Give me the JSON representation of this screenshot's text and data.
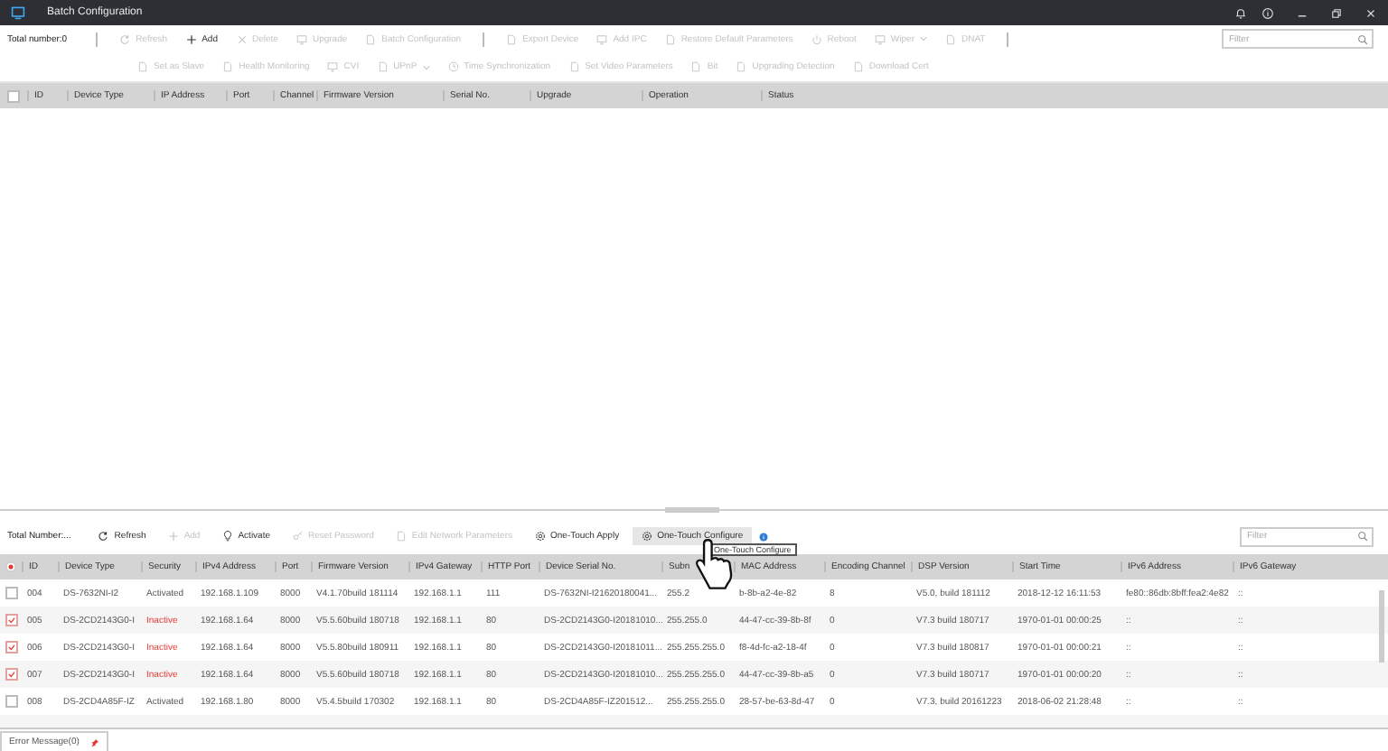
{
  "window": {
    "title": "Batch Configuration"
  },
  "upper_toolbar": {
    "total": "Total number:0",
    "filter_placeholder": "Filter",
    "primary_buttons": [
      {
        "label": "Refresh",
        "disabled": true
      },
      {
        "label": "Add",
        "disabled": false
      },
      {
        "label": "Delete",
        "disabled": true
      },
      {
        "label": "Upgrade",
        "disabled": true
      },
      {
        "label": "Batch Configuration",
        "disabled": true
      },
      {
        "label": "Export Device",
        "disabled": true
      },
      {
        "label": "Add IPC",
        "disabled": true
      },
      {
        "label": "Restore Default Parameters",
        "disabled": true
      },
      {
        "label": "Reboot",
        "disabled": true
      },
      {
        "label": "Wiper",
        "disabled": true
      },
      {
        "label": "DNAT",
        "disabled": true
      }
    ],
    "secondary_buttons": [
      {
        "label": "Set as Slave",
        "disabled": true
      },
      {
        "label": "Health Monitoring",
        "disabled": true
      },
      {
        "label": "CVI",
        "disabled": true
      },
      {
        "label": "UPnP",
        "disabled": true
      },
      {
        "label": "Time Synchronization",
        "disabled": true
      },
      {
        "label": "Set Video Parameters",
        "disabled": true
      },
      {
        "label": "Bit",
        "disabled": true
      },
      {
        "label": "Upgrading Detection",
        "disabled": true
      },
      {
        "label": "Download Cert",
        "disabled": true
      }
    ]
  },
  "upper_table": {
    "select_all_checked": false,
    "columns": [
      "ID",
      "Device Type",
      "IP Address",
      "Port",
      "Channel",
      "Firmware Version",
      "Serial No.",
      "Upgrade",
      "Operation",
      "Status"
    ]
  },
  "lower_toolbar": {
    "total": "Total Number:...",
    "filter_placeholder": "Filter",
    "buttons": [
      {
        "label": "Refresh",
        "disabled": false,
        "selected": false
      },
      {
        "label": "Add",
        "disabled": true,
        "selected": false
      },
      {
        "label": "Activate",
        "disabled": false,
        "selected": false
      },
      {
        "label": "Reset Password",
        "disabled": true,
        "selected": false
      },
      {
        "label": "Edit Network Parameters",
        "disabled": true,
        "selected": false
      },
      {
        "label": "One-Touch Apply",
        "disabled": false,
        "selected": false
      },
      {
        "label": "One-Touch Configure",
        "disabled": false,
        "selected": true
      }
    ],
    "tooltip": "One-Touch Configure"
  },
  "device_table": {
    "select_all_checked": true,
    "columns": [
      "ID",
      "Device Type",
      "Security",
      "IPv4 Address",
      "Port",
      "Firmware Version",
      "IPv4 Gateway",
      "HTTP Port",
      "Device Serial No.",
      "Subn",
      "MAC Address",
      "Encoding Channel",
      "DSP Version",
      "Start Time",
      "IPv6 Address",
      "IPv6 Gateway"
    ],
    "rows": [
      {
        "checked": false,
        "activated": true,
        "cells": [
          "004",
          "DS-7632NI-I2",
          "Activated",
          "192.168.1.109",
          "8000",
          "V4.1.70build 181114",
          "192.168.1.1",
          "111",
          "DS-7632NI-I21620180041...",
          "255.2",
          "b-8b-a2-4e-82",
          "8",
          "V5.0, build 181112",
          "2018-12-12 16:11:53",
          "fe80::86db:8bff:fea2:4e82",
          "::"
        ]
      },
      {
        "checked": true,
        "activated": false,
        "cells": [
          "005",
          "DS-2CD2143G0-I",
          "Inactive",
          "192.168.1.64",
          "8000",
          "V5.5.60build 180718",
          "192.168.1.1",
          "80",
          "DS-2CD2143G0-I20181010...",
          "255.255.0",
          "44-47-cc-39-8b-8f",
          "0",
          "V7.3 build 180717",
          "1970-01-01 00:00:25",
          "::",
          "::"
        ]
      },
      {
        "checked": true,
        "activated": false,
        "cells": [
          "006",
          "DS-2CD2143G0-I",
          "Inactive",
          "192.168.1.64",
          "8000",
          "V5.5.80build 180911",
          "192.168.1.1",
          "80",
          "DS-2CD2143G0-I20181011...",
          "255.255.255.0",
          "f8-4d-fc-a2-18-4f",
          "0",
          "V7.3 build 180817",
          "1970-01-01 00:00:21",
          "::",
          "::"
        ]
      },
      {
        "checked": true,
        "activated": false,
        "cells": [
          "007",
          "DS-2CD2143G0-I",
          "Inactive",
          "192.168.1.64",
          "8000",
          "V5.5.60build 180718",
          "192.168.1.1",
          "80",
          "DS-2CD2143G0-I20181010...",
          "255.255.255.0",
          "44-47-cc-39-8b-a5",
          "0",
          "V7.3 build 180717",
          "1970-01-01 00:00:20",
          "::",
          "::"
        ]
      },
      {
        "checked": false,
        "activated": true,
        "cells": [
          "008",
          "DS-2CD4A85F-IZ",
          "Activated",
          "192.168.1.80",
          "8000",
          "V5.4.5build 170302",
          "192.168.1.1",
          "80",
          "DS-2CD4A85F-IZ201512...",
          "255.255.255.0",
          "28-57-be-63-8d-47",
          "0",
          "V7.3, build 20161223",
          "2018-06-02 21:28:48",
          "::",
          "::"
        ]
      }
    ]
  },
  "bottom_tabs": [
    {
      "label": "Error Message(0)",
      "selected": true
    }
  ]
}
